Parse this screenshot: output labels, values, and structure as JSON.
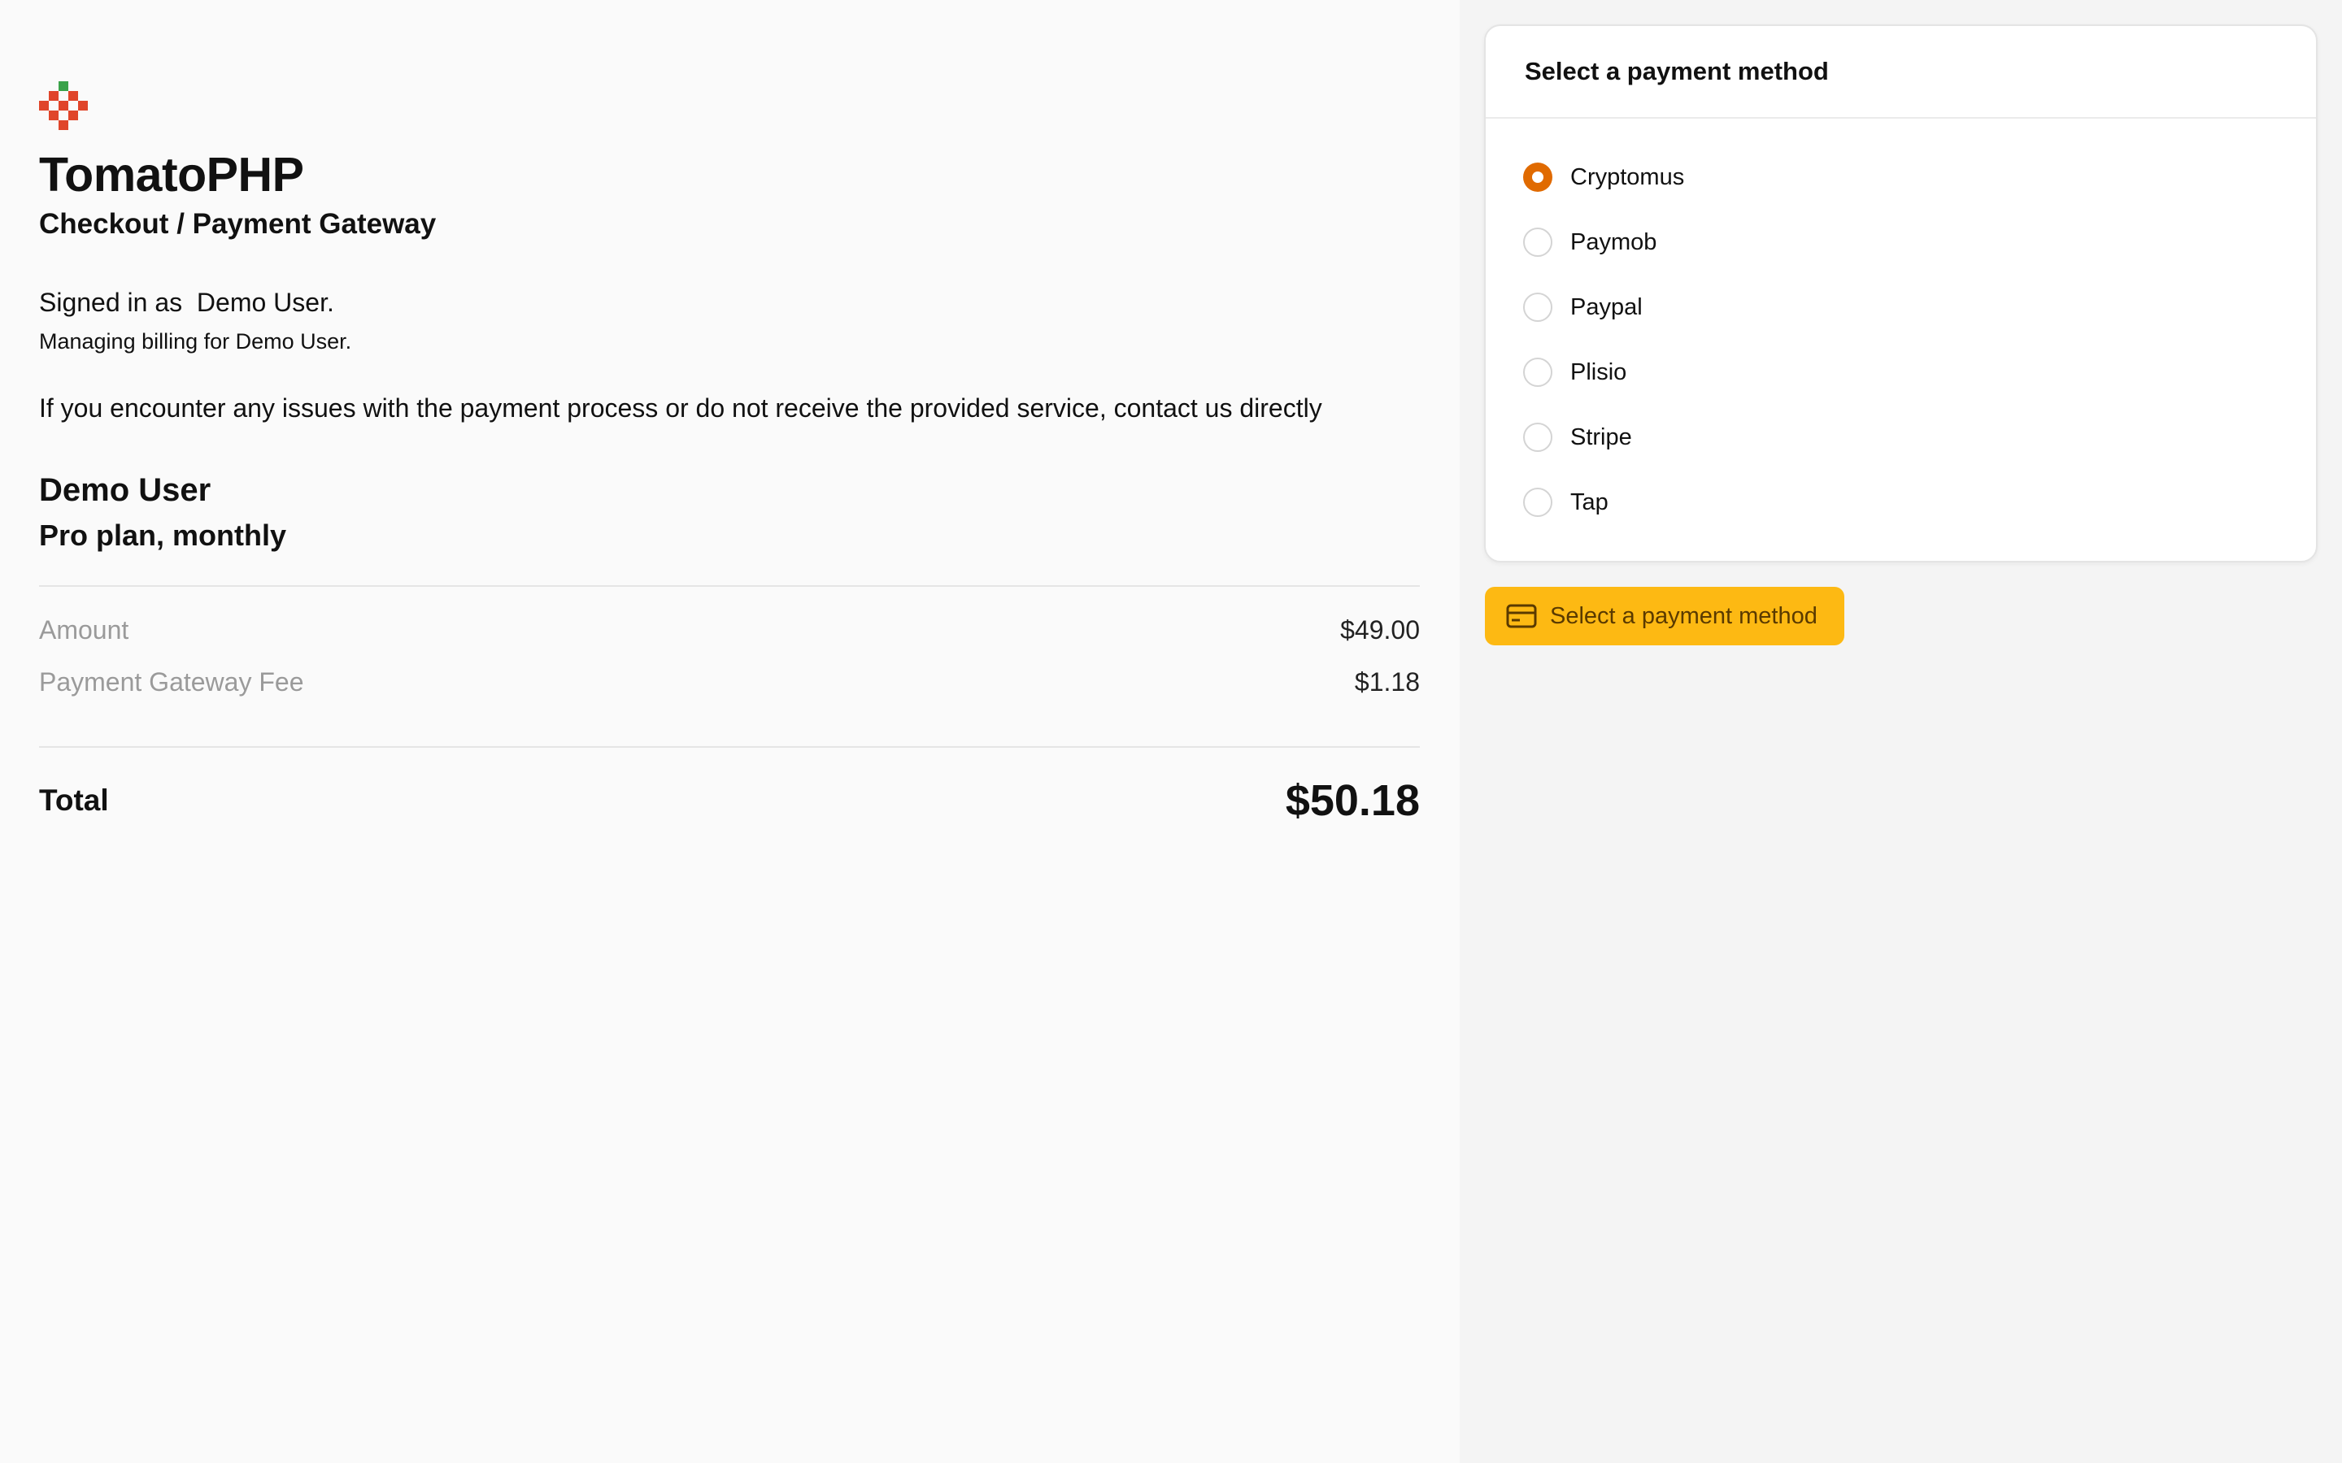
{
  "brand": {
    "logo_icon": "tomato-pixel-logo-icon",
    "app_name": "TomatoPHP",
    "page_subtitle": "Checkout / Payment Gateway",
    "colors": {
      "logo_red": "#e0452a",
      "logo_green": "#3aa34a"
    }
  },
  "account": {
    "signed_in_text": "Signed in as  Demo User.",
    "managing_text": "Managing billing for Demo User."
  },
  "notice_text": "If you encounter any issues with the payment process or do not receive the provided service, contact us directly",
  "order": {
    "customer_name": "Demo User",
    "plan_name": "Pro plan, monthly",
    "line_items": [
      {
        "label": "Amount",
        "value": "$49.00"
      },
      {
        "label": "Payment Gateway Fee",
        "value": "$1.18"
      }
    ],
    "total_label": "Total",
    "total_value": "$50.18"
  },
  "payment": {
    "card_title": "Select a payment method",
    "selected": "Cryptomus",
    "methods": [
      "Cryptomus",
      "Paymob",
      "Paypal",
      "Plisio",
      "Stripe",
      "Tap"
    ],
    "button_label": "Select a payment method",
    "button_icon": "credit-card-icon",
    "colors": {
      "accent": "#e06a00",
      "button_bg": "#fdb913",
      "button_text": "#5a3a00"
    }
  }
}
